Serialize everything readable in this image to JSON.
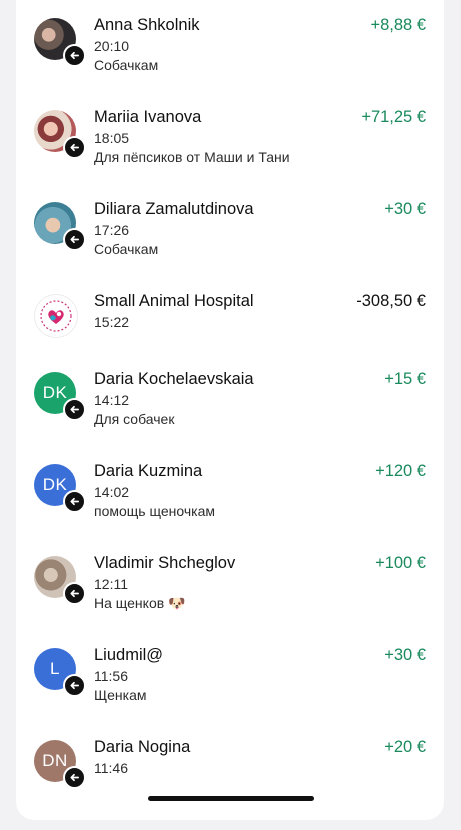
{
  "transactions": [
    {
      "name": "Anna Shkolnik",
      "time": "20:10",
      "note": "Собачкам",
      "amount": "+8,88 €",
      "direction": "incoming",
      "avatar": {
        "kind": "photo",
        "initials": ""
      }
    },
    {
      "name": "Mariia Ivanova",
      "time": "18:05",
      "note": "Для пёпсиков от Маши и Тани",
      "amount": "+71,25 €",
      "direction": "incoming",
      "avatar": {
        "kind": "photo",
        "initials": ""
      }
    },
    {
      "name": "Diliara Zamalutdinova",
      "time": "17:26",
      "note": "Собачкам",
      "amount": "+30 €",
      "direction": "incoming",
      "avatar": {
        "kind": "photo",
        "initials": ""
      }
    },
    {
      "name": "Small Animal Hospital",
      "time": "15:22",
      "note": "",
      "amount": "-308,50 €",
      "direction": "outgoing",
      "avatar": {
        "kind": "logo",
        "initials": ""
      }
    },
    {
      "name": "Daria Kochelaevskaia",
      "time": "14:12",
      "note": "Для собачек",
      "amount": "+15 €",
      "direction": "incoming",
      "avatar": {
        "kind": "initials",
        "initials": "DK",
        "color": "#1aa36b"
      }
    },
    {
      "name": "Daria Kuzmina",
      "time": "14:02",
      "note": "помощь щеночкам",
      "amount": "+120 €",
      "direction": "incoming",
      "avatar": {
        "kind": "initials",
        "initials": "DK",
        "color": "#3a6fd8"
      }
    },
    {
      "name": "Vladimir Shcheglov",
      "time": "12:11",
      "note": "На щенков 🐶",
      "amount": "+100 €",
      "direction": "incoming",
      "avatar": {
        "kind": "photo",
        "initials": ""
      }
    },
    {
      "name": "Liudmil@",
      "time": "11:56",
      "note": "Щенкам",
      "amount": "+30 €",
      "direction": "incoming",
      "avatar": {
        "kind": "initials",
        "initials": "L",
        "color": "#3a6fd8"
      }
    },
    {
      "name": "Daria Nogina",
      "time": "11:46",
      "note": "",
      "amount": "+20 €",
      "direction": "incoming",
      "avatar": {
        "kind": "initials",
        "initials": "DN",
        "color": "#a0786a"
      }
    }
  ],
  "colors": {
    "positive_amount": "#1a8a5c",
    "negative_amount": "#111111",
    "background": "#f2f2f4"
  },
  "icons": {
    "incoming_badge": "arrow-left-icon"
  }
}
